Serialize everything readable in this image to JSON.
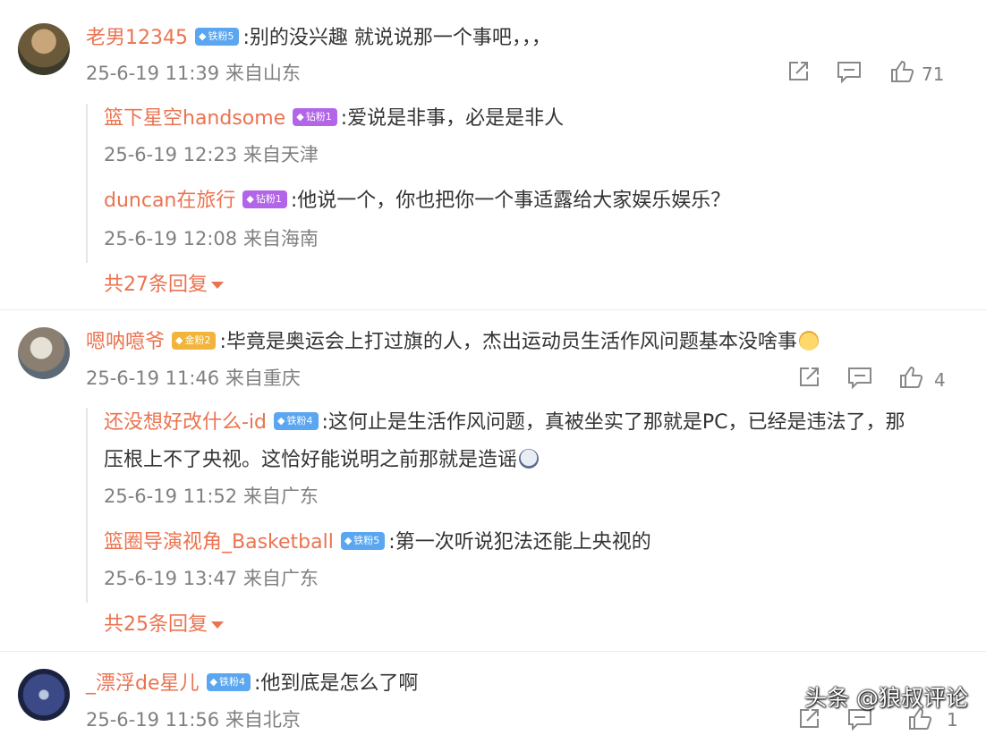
{
  "comments": [
    {
      "user": "老男12345",
      "badge": "铁粉5",
      "text": ":别的没兴趣 就说说那一个事吧，，，",
      "meta": "25-6-19 11:39 来自山东",
      "likes": "71",
      "replies": [
        {
          "user": "篮下星空handsome",
          "badge": "钻粉1",
          "text": ":爱说是非事，必是是非人",
          "meta": "25-6-19 12:23 来自天津"
        },
        {
          "user": "duncan在旅行",
          "badge": "钻粉1",
          "text": ":他说一个，你也把你一个事适露给大家娱乐娱乐？",
          "meta": "25-6-19 12:08 来自海南"
        }
      ],
      "more_replies": "共27条回复"
    },
    {
      "user": "嗯呐噫爷",
      "badge": "金粉2",
      "text": ":毕竟是奥运会上打过旗的人，杰出运动员生活作风问题基本没啥事",
      "meta": "25-6-19 11:46 来自重庆",
      "likes": "4",
      "replies": [
        {
          "user": "还没想好改什么-id",
          "badge": "铁粉4",
          "text": ":这何止是生活作风问题，真被坐实了那就是PC，已经是违法了，那",
          "text2": "压根上不了央视。这恰好能说明之前那就是造谣",
          "meta": "25-6-19 11:52 来自广东"
        },
        {
          "user": "篮圈导演视角_Basketball",
          "badge": "铁粉5",
          "text": ":第一次听说犯法还能上央视的",
          "meta": "25-6-19 13:47 来自广东"
        }
      ],
      "more_replies": "共25条回复"
    },
    {
      "user": "_漂浮de星儿",
      "badge": "铁粉4",
      "text": ":他到底是怎么了啊",
      "meta": "25-6-19 11:56 来自北京",
      "likes": "1"
    }
  ],
  "watermark": "头条 @狼叔评论",
  "icons": [
    "share-icon",
    "comment-icon",
    "like-icon",
    "diamond-icon",
    "chevron-down-icon"
  ],
  "colors": {
    "username": "#eb7350",
    "meta": "#808080",
    "badge_iron": "#5aa6f0",
    "badge_diamond": "#b265e8",
    "badge_gold": "#f2b43a"
  }
}
